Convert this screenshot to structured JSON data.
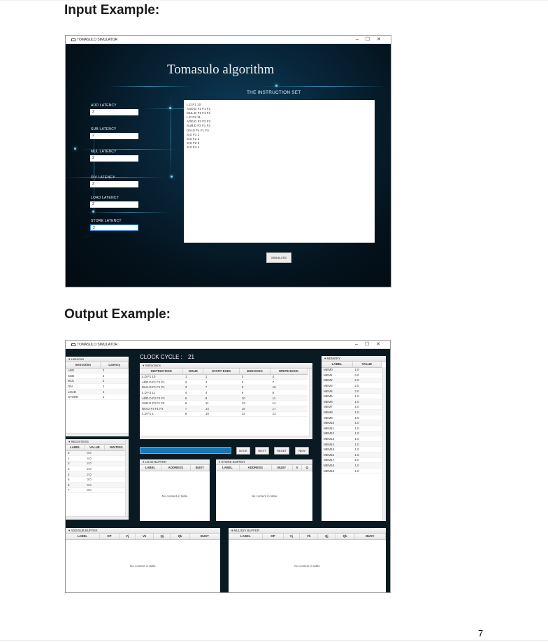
{
  "headings": {
    "input": "Input Example:",
    "output": "Output Example:"
  },
  "page_number": "7",
  "input_window": {
    "title": "TOMASULO SIMULATOR",
    "controls": [
      "–",
      "☐",
      "✕"
    ],
    "heading": "Tomasulo algorithm",
    "instruction_set_label": "THE INSTRUCTION SET",
    "latency_fields": [
      {
        "label": "ADD LATENCY",
        "value": "2"
      },
      {
        "label": "SUB LATENCY",
        "value": "2"
      },
      {
        "label": "MUL LATENCY",
        "value": "2"
      },
      {
        "label": "DIV LATENCY",
        "value": "2"
      },
      {
        "label": "LOAD LATENCY",
        "value": "2"
      },
      {
        "label": "STORE LATENCY",
        "value": "2"
      }
    ],
    "instructions": [
      "L.D F1 10",
      "ADD.D F1 F1 F1",
      "MUL.D F1 F1 F1",
      "L.D F2 11",
      "ADD.D F2 F2 F2",
      "SUB.D F3 F1 F2",
      "DIV.D F4 F1 F3",
      "S.D F1 1",
      "S.D F2 2",
      "S.D F3 3",
      "S.D F4 4"
    ],
    "simulate_label": "SIMULATE"
  },
  "output_window": {
    "title": "TOMASULO SIMULATOR",
    "controls": [
      "–",
      "☐",
      "✕"
    ],
    "clock_label": "CLOCK CYCLE :",
    "clock_value": "21",
    "latencies": {
      "title": "Latencies",
      "headers": [
        "Instruction",
        "Latency"
      ],
      "rows": [
        [
          "ADD",
          "2"
        ],
        [
          "SUB",
          "2"
        ],
        [
          "MUL",
          "2"
        ],
        [
          "DIV",
          "2"
        ],
        [
          "LOAD",
          "2"
        ],
        [
          "STORE",
          "2"
        ]
      ]
    },
    "instructions_panel": {
      "title": "Instructions",
      "headers": [
        "INSTRUCTION",
        "ISSUE",
        "START EXEC",
        "END EXEC",
        "WRITE BACK"
      ],
      "rows": [
        [
          "L.D F1 10",
          "1",
          "1",
          "3",
          "4"
        ],
        [
          "ADD.D F1 F1 F1",
          "2",
          "4",
          "6",
          "7"
        ],
        [
          "MUL.D F1 F1 F1",
          "3",
          "7",
          "9",
          "10"
        ],
        [
          "L.D F2 11",
          "4",
          "4",
          "6",
          "8"
        ],
        [
          "ADD.D F2 F2 F2",
          "5",
          "8",
          "10",
          "11"
        ],
        [
          "SUB.D F3 F1 F2",
          "6",
          "11",
          "13",
          "14"
        ],
        [
          "DIV.D F4 F1 F3",
          "7",
          "14",
          "16",
          "17"
        ],
        [
          "L.D F1 1",
          "8",
          "10",
          "12",
          "13"
        ]
      ]
    },
    "memory": {
      "title": "MEMORY",
      "headers": [
        "LABEL",
        "VALUE"
      ],
      "rows": [
        [
          "MEM0",
          "1.0"
        ],
        [
          "MEM1",
          "4.0"
        ],
        [
          "MEM2",
          "2.0"
        ],
        [
          "MEM3",
          "2.0"
        ],
        [
          "MEM4",
          "2.0"
        ],
        [
          "MEM5",
          "1.0"
        ],
        [
          "MEM6",
          "1.0"
        ],
        [
          "MEM7",
          "1.0"
        ],
        [
          "MEM8",
          "1.0"
        ],
        [
          "MEM9",
          "1.0"
        ],
        [
          "MEM10",
          "1.0"
        ],
        [
          "MEM11",
          "1.0"
        ],
        [
          "MEM12",
          "1.0"
        ],
        [
          "MEM13",
          "1.0"
        ],
        [
          "MEM14",
          "1.0"
        ],
        [
          "MEM15",
          "1.0"
        ],
        [
          "MEM16",
          "1.0"
        ],
        [
          "MEM17",
          "1.0"
        ],
        [
          "MEM18",
          "1.0"
        ],
        [
          "MEM19",
          "1.0"
        ]
      ]
    },
    "registers": {
      "title": "REGISTERS",
      "headers": [
        "LABEL",
        "VALUE",
        "WAITING"
      ],
      "rows": [
        [
          "0",
          "0.0",
          ""
        ],
        [
          "1",
          "4.0",
          ""
        ],
        [
          "2",
          "2.0",
          ""
        ],
        [
          "3",
          "2.0",
          ""
        ],
        [
          "4",
          "2.0",
          ""
        ],
        [
          "5",
          "0.0",
          ""
        ],
        [
          "6",
          "0.0",
          ""
        ],
        [
          "7",
          "0.0",
          ""
        ]
      ]
    },
    "buttons": {
      "back": "BACK",
      "next": "NEXT",
      "reset": "RESET",
      "new": "NEW"
    },
    "load_buffer": {
      "title": "LOAD BUFFER",
      "headers": [
        "LABEL",
        "ADDRESS",
        "BUSY"
      ],
      "empty": "No content in table"
    },
    "store_buffer": {
      "title": "STORE BUFFER",
      "headers": [
        "LABEL",
        "ADDRESS",
        "BUSY",
        "V",
        "Q"
      ],
      "empty": "No content in table"
    },
    "addsub_buffer": {
      "title": "ADD/SUB BUFFER",
      "headers": [
        "LABEL",
        "OP",
        "Vj",
        "Vk",
        "Qj",
        "Qk",
        "BUSY"
      ],
      "empty": "No content in table"
    },
    "muldiv_buffer": {
      "title": "MUL/DIV BUFFER",
      "headers": [
        "LABEL",
        "OP",
        "Vj",
        "Vk",
        "Qj",
        "Qk",
        "BUSY"
      ],
      "empty": "No content in table"
    }
  }
}
